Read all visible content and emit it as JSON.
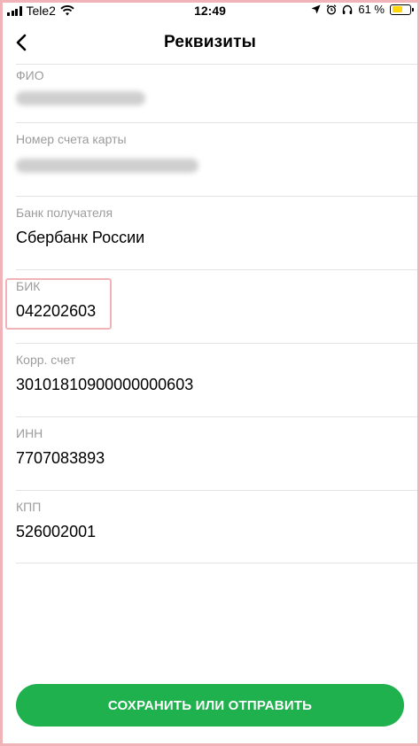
{
  "status_bar": {
    "carrier": "Tele2",
    "time": "12:49",
    "battery_percent": "61 %",
    "battery_level": 0.61,
    "battery_color": "#ffd60a"
  },
  "nav": {
    "title": "Реквизиты",
    "back_icon": "chevron-left-icon"
  },
  "fields": [
    {
      "label": "ФИО",
      "value": null,
      "obscured": true
    },
    {
      "label": "Номер счета карты",
      "value": null,
      "obscured": true
    },
    {
      "label": "Банк получателя",
      "value": "Сбербанк России"
    },
    {
      "label": "БИК",
      "value": "042202603",
      "highlighted": true
    },
    {
      "label": "Корр. счет",
      "value": "30101810900000000603"
    },
    {
      "label": "ИНН",
      "value": "7707083893"
    },
    {
      "label": "КПП",
      "value": "526002001"
    }
  ],
  "actions": {
    "save_label": "СОХРАНИТЬ ИЛИ ОТПРАВИТЬ",
    "accent_color": "#1fb14d"
  }
}
